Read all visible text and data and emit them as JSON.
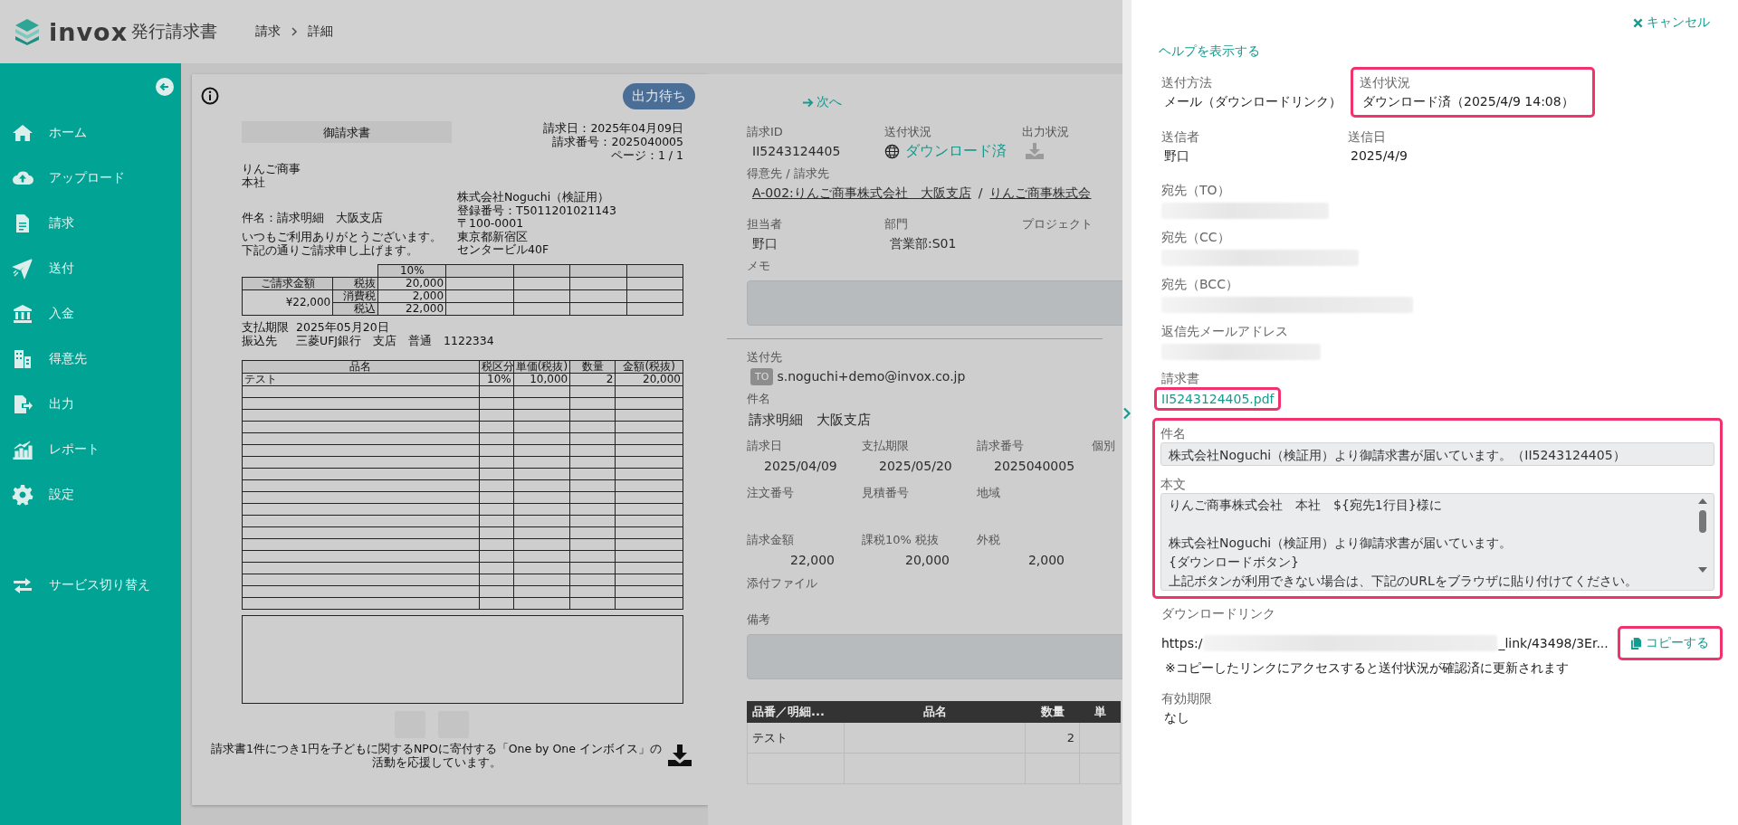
{
  "header": {
    "logo_text": "invox",
    "product": "発行請求書",
    "breadcrumb": [
      "請求",
      "詳細"
    ]
  },
  "sidebar": {
    "items": [
      {
        "label": "ホーム"
      },
      {
        "label": "アップロード"
      },
      {
        "label": "請求"
      },
      {
        "label": "送付"
      },
      {
        "label": "入金"
      },
      {
        "label": "得意先"
      },
      {
        "label": "出力"
      },
      {
        "label": "レポート"
      },
      {
        "label": "設定"
      }
    ],
    "service_switch": "サービス切り替え"
  },
  "document": {
    "status_badge": "出力待ち",
    "title": "御請求書",
    "meta": [
      "請求日：2025年04月09日",
      "請求番号：2025040005",
      "ページ：1 / 1"
    ],
    "customer": [
      "りんご商事",
      "本社"
    ],
    "issuer": [
      "株式会社Noguchi（検証用）",
      "登録番号：T5011201021143",
      "〒100-0001",
      "東京都新宿区",
      "センタービル40F"
    ],
    "subject": "件名：請求明細　大阪支店",
    "greeting": [
      "いつもご利用ありがとうございます。",
      "下記の通りご請求申し上げます。"
    ],
    "summary": {
      "amount_label": "ご請求金額",
      "amount": "¥22,000",
      "rate": "10%",
      "rows": [
        {
          "label": "税抜",
          "value": "20,000"
        },
        {
          "label": "消費税",
          "value": "2,000"
        },
        {
          "label": "税込",
          "value": "22,000"
        }
      ]
    },
    "payment": [
      {
        "label": "支払期限",
        "value": "2025年05月20日"
      },
      {
        "label": "振込先",
        "value": "三菱UFJ銀行　支店　普通　1122334"
      }
    ],
    "items": {
      "columns": [
        "品名",
        "税区分",
        "単価(税抜)",
        "数量",
        "金額(税抜)"
      ],
      "rows": [
        [
          "テスト",
          "10%",
          "10,000",
          "2",
          "20,000"
        ]
      ]
    },
    "footer": "請求書1件につき1円を子どもに関するNPOに寄付する「One by One インボイス」の活動を応援しています。"
  },
  "detail": {
    "next": "次へ",
    "row1": [
      {
        "label": "請求ID",
        "value": "II5243124405",
        "kind": "text"
      },
      {
        "label": "送付状況",
        "value": "ダウンロード済",
        "kind": "status"
      },
      {
        "label": "出力状況",
        "kind": "icon"
      }
    ],
    "customer": {
      "label": "得意先 / 請求先",
      "links": [
        "A-002:りんご商事株式会社　大阪支店",
        "りんご商事株式会"
      ],
      "separator": "/"
    },
    "row2": [
      {
        "label": "担当者",
        "value": "野口"
      },
      {
        "label": "部門",
        "value": "営業部:S01"
      },
      {
        "label": "プロジェクト"
      }
    ],
    "memo_label": "メモ",
    "recipient": {
      "label": "送付先",
      "tag": "TO",
      "email": "s.noguchi+demo@invox.co.jp"
    },
    "subject": {
      "label": "件名",
      "value": "請求明細　大阪支店"
    },
    "grid": [
      [
        {
          "label": "請求日",
          "value": "2025/04/09"
        },
        {
          "label": "支払期限",
          "value": "2025/05/20"
        },
        {
          "label": "請求番号",
          "value": "2025040005"
        },
        {
          "label": "個別"
        }
      ],
      [
        {
          "label": "注文番号"
        },
        {
          "label": "見積番号"
        },
        {
          "label": "地域"
        }
      ],
      [
        {
          "label": "請求金額",
          "value": "22,000"
        },
        {
          "label": "課税10% 税抜",
          "value": "20,000"
        },
        {
          "label": "外税",
          "value": "2,000"
        }
      ]
    ],
    "attachments_label": "添付ファイル",
    "remarks_label": "備考",
    "table": {
      "columns": [
        "品番／明細...",
        "品名",
        "数量",
        "単"
      ],
      "rows": [
        {
          "code": "テスト",
          "quantity": "2"
        }
      ]
    }
  },
  "drawer": {
    "cancel": "キャンセル",
    "help": "ヘルプを表示する",
    "pairs": [
      [
        {
          "label": "送付方法",
          "value": "メール（ダウンロードリンク）",
          "highlighted": false
        },
        {
          "label": "送付状況",
          "value": "ダウンロード済（2025/4/9 14:08）",
          "highlighted": true
        }
      ],
      [
        {
          "label": "送信者",
          "value": "野口",
          "highlighted": false
        },
        {
          "label": "送信日",
          "value": "2025/4/9",
          "highlighted": false
        }
      ]
    ],
    "addresses": [
      "宛先（TO）",
      "宛先（CC）",
      "宛先（BCC）",
      "返信先メールアドレス"
    ],
    "invoice": {
      "label": "請求書",
      "link": "II5243124405.pdf",
      "highlighted": true
    },
    "message": {
      "highlighted": true,
      "subject_label": "件名",
      "subject": "株式会社Noguchi（検証用）より御請求書が届いています。（II5243124405）",
      "body_label": "本文",
      "body": [
        [
          "りんご商事株式会社　本社　${宛先1行目}様に"
        ],
        [
          "株式会社Noguchi（検証用）より御請求書が届いています。",
          "{ダウンロードボタン}",
          "上記ボタンが利用できない場合は、下記のURLをブラウザに貼り付けてください。"
        ]
      ]
    },
    "download": {
      "label": "ダウンロードリンク",
      "url_prefix": "https:/",
      "url_suffix": "_link/43498/3Er...",
      "copy": "コピーする",
      "copy_highlighted": true,
      "note": "※コピーしたリンクにアクセスすると送付状況が確認済に更新されます"
    },
    "expiry": {
      "label": "有効期限",
      "value": "なし"
    }
  }
}
